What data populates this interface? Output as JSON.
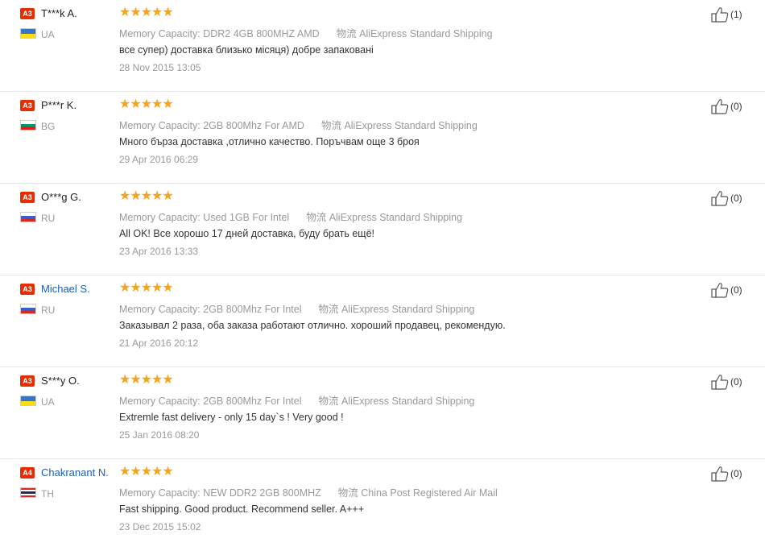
{
  "reviews": [
    {
      "badge": "A3",
      "name": "T***k A.",
      "name_is_link": false,
      "country": "UA",
      "flag": "UA",
      "rating": "★★★★★",
      "attr_label": "Memory Capacity:",
      "attr_value": "DDR2 4GB 800MHZ AMD",
      "logistics_label": "物流",
      "logistics_value": "AliExpress Standard Shipping",
      "text": "все супер) доставка близько місяця) добре запаковані",
      "date": "28 Nov 2015 13:05",
      "helpful": "(1)"
    },
    {
      "badge": "A3",
      "name": "P***r K.",
      "name_is_link": false,
      "country": "BG",
      "flag": "BG",
      "rating": "★★★★★",
      "attr_label": "Memory Capacity:",
      "attr_value": "2GB 800Mhz For AMD",
      "logistics_label": "物流",
      "logistics_value": "AliExpress Standard Shipping",
      "text": "Много бърза доставка ,отлично качество. Поръчвам още 3 броя",
      "date": "29 Apr 2016 06:29",
      "helpful": "(0)"
    },
    {
      "badge": "A3",
      "name": "O***g G.",
      "name_is_link": false,
      "country": "RU",
      "flag": "RU",
      "rating": "★★★★★",
      "attr_label": "Memory Capacity:",
      "attr_value": "Used 1GB For Intel",
      "logistics_label": "物流",
      "logistics_value": "AliExpress Standard Shipping",
      "text": "All OK! Все хорошо 17 дней доставка, буду брать ещё!",
      "date": "23 Apr 2016 13:33",
      "helpful": "(0)"
    },
    {
      "badge": "A3",
      "name": "Michael S.",
      "name_is_link": true,
      "country": "RU",
      "flag": "RU",
      "rating": "★★★★★",
      "attr_label": "Memory Capacity:",
      "attr_value": "2GB 800Mhz For Intel",
      "logistics_label": "物流",
      "logistics_value": "AliExpress Standard Shipping",
      "text": "Заказывал 2 раза, оба заказа работают отлично. хороший продавец, рекомендую.",
      "date": "21 Apr 2016 20:12",
      "helpful": "(0)"
    },
    {
      "badge": "A3",
      "name": "S***y O.",
      "name_is_link": false,
      "country": "UA",
      "flag": "UA",
      "rating": "★★★★★",
      "attr_label": "Memory Capacity:",
      "attr_value": "2GB 800Mhz For Intel",
      "logistics_label": "物流",
      "logistics_value": "AliExpress Standard Shipping",
      "text": "Extremle fast delivery - only 15 day`s ! Very good !",
      "date": "25 Jan 2016 08:20",
      "helpful": "(0)"
    },
    {
      "badge": "A4",
      "name": "Chakranant N.",
      "name_is_link": true,
      "country": "TH",
      "flag": "TH",
      "rating": "★★★★★",
      "attr_label": "Memory Capacity:",
      "attr_value": "NEW DDR2 2GB 800MHZ",
      "logistics_label": "物流",
      "logistics_value": "China Post Registered Air Mail",
      "text": "Fast shipping. Good product. Recommend seller. A+++",
      "date": "23 Dec 2015 15:02",
      "helpful": "(0)"
    }
  ],
  "colors": {
    "badge": "#e62e04",
    "star": "#f7a31c",
    "link": "#1a5fb4",
    "UA": [
      "#3a75c4",
      "#f9dd16"
    ],
    "BG": [
      "#ffffff",
      "#00966e",
      "#d62612"
    ],
    "RU": [
      "#ffffff",
      "#3a5fcd",
      "#d52b1e"
    ],
    "TH": [
      "#d52b1e",
      "#ffffff",
      "#2d2a4a",
      "#2d2a4a",
      "#ffffff",
      "#d52b1e"
    ]
  }
}
